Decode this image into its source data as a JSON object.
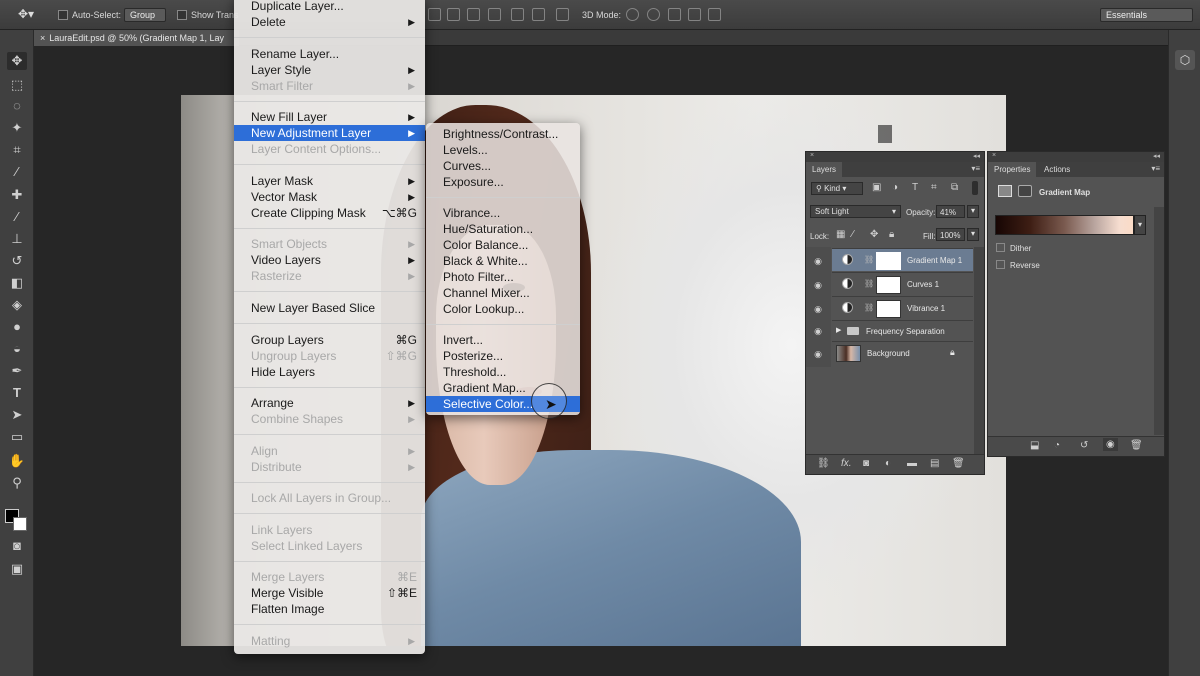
{
  "options_bar": {
    "auto_select_label": "Auto-Select:",
    "auto_select_value": "Group",
    "show_transform_label": "Show Trans",
    "mode_3d_label": "3D Mode:",
    "workspace": "Essentials"
  },
  "document_tab": {
    "title": "LauraEdit.psd @ 50% (Gradient Map 1, Lay"
  },
  "layer_menu": {
    "items": [
      {
        "label": "Duplicate Layer...",
        "disabled": false
      },
      {
        "label": "Delete",
        "disabled": false,
        "submenu": true
      },
      {
        "label": "Rename Layer...",
        "disabled": false
      },
      {
        "label": "Layer Style",
        "disabled": false,
        "submenu": true
      },
      {
        "label": "Smart Filter",
        "disabled": true,
        "submenu": true
      },
      {
        "label": "New Fill Layer",
        "disabled": false,
        "submenu": true
      },
      {
        "label": "New Adjustment Layer",
        "disabled": false,
        "submenu": true,
        "highlighted": true
      },
      {
        "label": "Layer Content Options...",
        "disabled": true
      },
      {
        "label": "Layer Mask",
        "disabled": false,
        "submenu": true
      },
      {
        "label": "Vector Mask",
        "disabled": false,
        "submenu": true
      },
      {
        "label": "Create Clipping Mask",
        "disabled": false,
        "shortcut": "⌥⌘G"
      },
      {
        "label": "Smart Objects",
        "disabled": true,
        "submenu": true
      },
      {
        "label": "Video Layers",
        "disabled": false,
        "submenu": true
      },
      {
        "label": "Rasterize",
        "disabled": true,
        "submenu": true
      },
      {
        "label": "New Layer Based Slice",
        "disabled": false
      },
      {
        "label": "Group Layers",
        "disabled": false,
        "shortcut": "⌘G"
      },
      {
        "label": "Ungroup Layers",
        "disabled": true,
        "shortcut": "⇧⌘G"
      },
      {
        "label": "Hide Layers",
        "disabled": false
      },
      {
        "label": "Arrange",
        "disabled": false,
        "submenu": true
      },
      {
        "label": "Combine Shapes",
        "disabled": true,
        "submenu": true
      },
      {
        "label": "Align",
        "disabled": true,
        "submenu": true
      },
      {
        "label": "Distribute",
        "disabled": true,
        "submenu": true
      },
      {
        "label": "Lock All Layers in Group...",
        "disabled": true
      },
      {
        "label": "Link Layers",
        "disabled": true
      },
      {
        "label": "Select Linked Layers",
        "disabled": true
      },
      {
        "label": "Merge Layers",
        "disabled": true,
        "shortcut": "⌘E"
      },
      {
        "label": "Merge Visible",
        "disabled": false,
        "shortcut": "⇧⌘E"
      },
      {
        "label": "Flatten Image",
        "disabled": false
      },
      {
        "label": "Matting",
        "disabled": true,
        "submenu": true
      }
    ]
  },
  "adjustment_submenu": {
    "items": [
      {
        "label": "Brightness/Contrast..."
      },
      {
        "label": "Levels..."
      },
      {
        "label": "Curves..."
      },
      {
        "label": "Exposure..."
      },
      {
        "label": "Vibrance..."
      },
      {
        "label": "Hue/Saturation..."
      },
      {
        "label": "Color Balance..."
      },
      {
        "label": "Black & White..."
      },
      {
        "label": "Photo Filter..."
      },
      {
        "label": "Channel Mixer..."
      },
      {
        "label": "Color Lookup..."
      },
      {
        "label": "Invert..."
      },
      {
        "label": "Posterize..."
      },
      {
        "label": "Threshold..."
      },
      {
        "label": "Gradient Map..."
      },
      {
        "label": "Selective Color...",
        "highlighted": true
      }
    ]
  },
  "layers_panel": {
    "tab": "Layers",
    "filter_kind": "Kind",
    "blend_mode": "Soft Light",
    "opacity_label": "Opacity:",
    "opacity_value": "41%",
    "lock_label": "Lock:",
    "fill_label": "Fill:",
    "fill_value": "100%",
    "layers": [
      {
        "name": "Gradient Map 1",
        "selected": true
      },
      {
        "name": "Curves 1"
      },
      {
        "name": "Vibrance 1"
      },
      {
        "name": "Frequency Separation",
        "group": true
      },
      {
        "name": "Background",
        "locked": true
      }
    ]
  },
  "properties_panel": {
    "tabs": [
      "Properties",
      "Actions"
    ],
    "title": "Gradient Map",
    "dither_label": "Dither",
    "reverse_label": "Reverse"
  }
}
